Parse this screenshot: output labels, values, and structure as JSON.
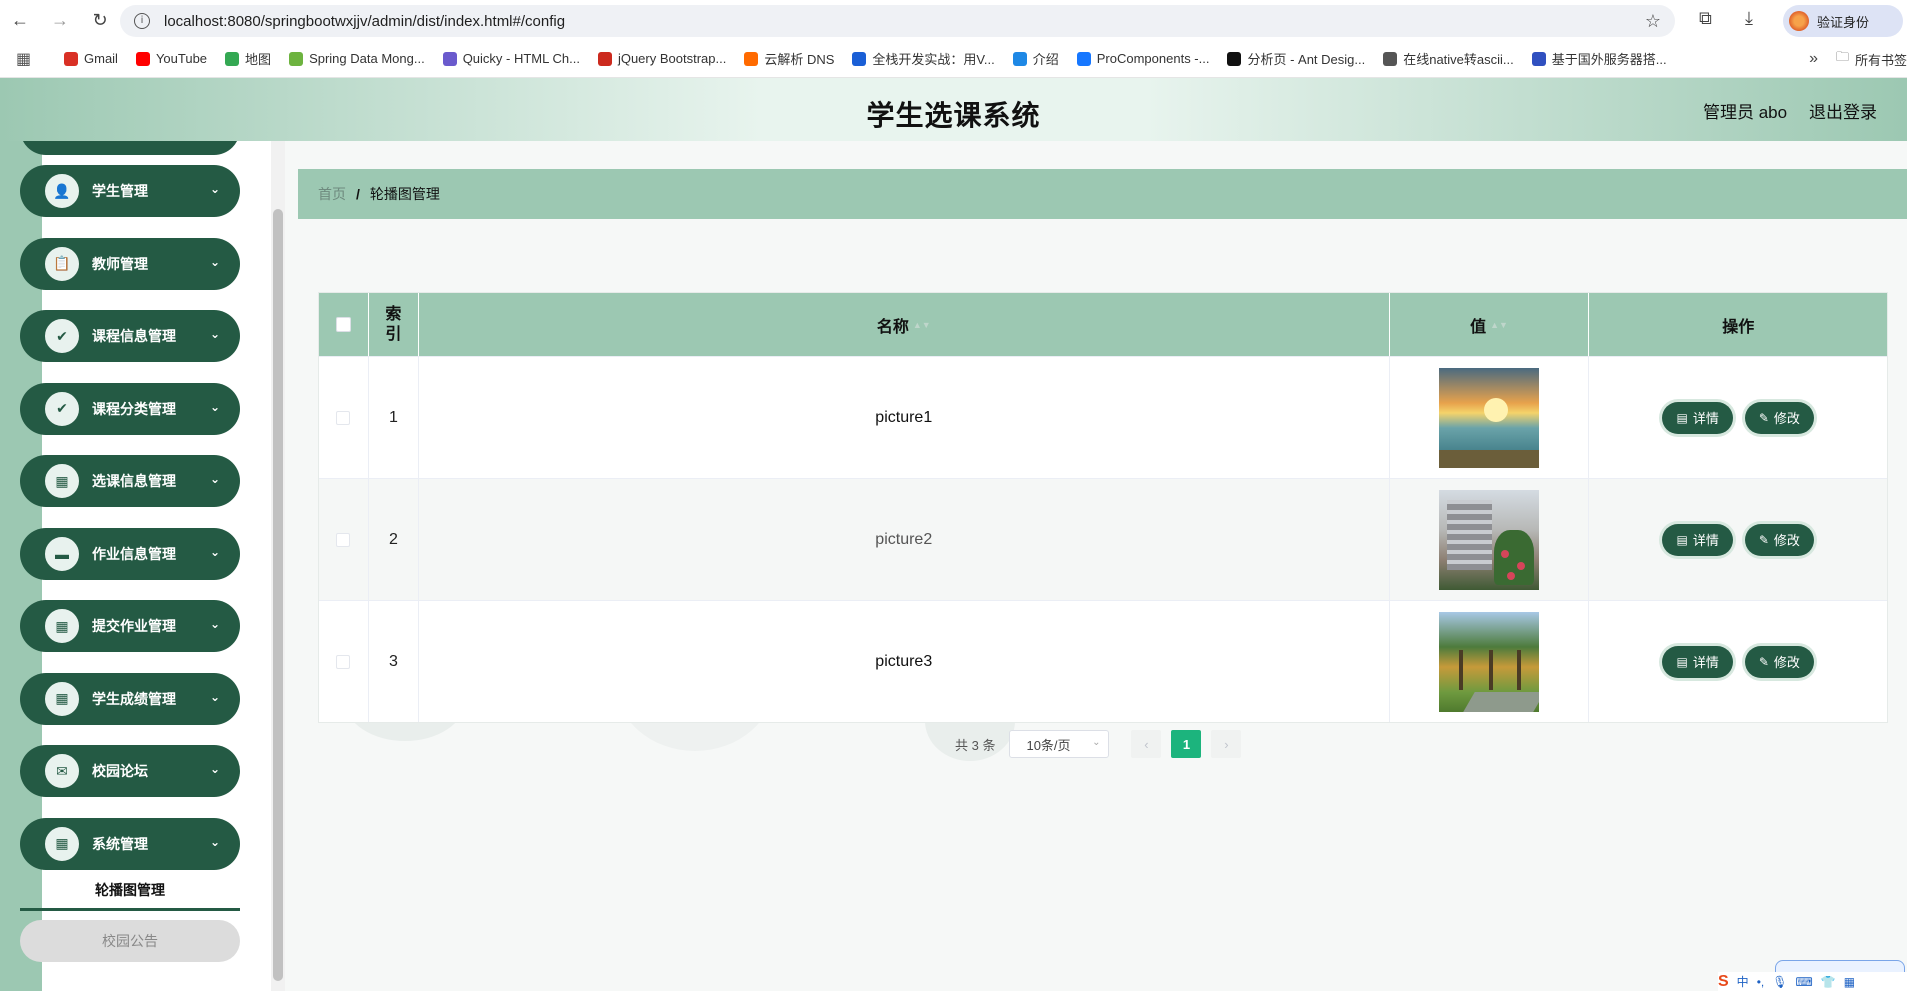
{
  "browser": {
    "url": "localhost:8080/springbootwxjjv/admin/dist/index.html#/config",
    "verify_label": "验证身份",
    "bookmarks": [
      {
        "label": "Gmail",
        "color": "#d93025"
      },
      {
        "label": "YouTube",
        "color": "#ff0000"
      },
      {
        "label": "地图",
        "color": "#34a853"
      },
      {
        "label": "Spring Data Mong...",
        "color": "#6db33f"
      },
      {
        "label": "Quicky - HTML Ch...",
        "color": "#6a5acd"
      },
      {
        "label": "jQuery Bootstrap...",
        "color": "#cc2a1e"
      },
      {
        "label": "云解析 DNS",
        "color": "#ff6a00"
      },
      {
        "label": "全栈开发实战：用V...",
        "color": "#1a5fd6"
      },
      {
        "label": "介绍",
        "color": "#1e88e5"
      },
      {
        "label": "ProComponents -...",
        "color": "#1677ff"
      },
      {
        "label": "分析页 - Ant Desig...",
        "color": "#111111"
      },
      {
        "label": "在线native转ascii...",
        "color": "#555555"
      },
      {
        "label": "基于国外服务器搭...",
        "color": "#3050c0"
      }
    ],
    "all_bookmarks": "所有书签"
  },
  "header": {
    "title": "学生选课系统",
    "admin": "管理员 abo",
    "logout": "退出登录"
  },
  "sidebar": {
    "items": [
      {
        "label": "学生管理",
        "icon": "user-icon"
      },
      {
        "label": "教师管理",
        "icon": "clipboard-icon"
      },
      {
        "label": "课程信息管理",
        "icon": "clipboard-check-icon"
      },
      {
        "label": "课程分类管理",
        "icon": "clipboard-check-icon"
      },
      {
        "label": "选课信息管理",
        "icon": "grid-icon"
      },
      {
        "label": "作业信息管理",
        "icon": "monitor-icon"
      },
      {
        "label": "提交作业管理",
        "icon": "grid-icon"
      },
      {
        "label": "学生成绩管理",
        "icon": "grid-icon"
      },
      {
        "label": "校园论坛",
        "icon": "chat-icon"
      },
      {
        "label": "系统管理",
        "icon": "grid-icon"
      }
    ],
    "sub_active": "轮播图管理",
    "sub_item": "校园公告"
  },
  "breadcrumb": {
    "home": "首页",
    "separator": "/",
    "current": "轮播图管理"
  },
  "table": {
    "headers": {
      "index": [
        "索",
        "引"
      ],
      "name": "名称",
      "value": "值",
      "actions": "操作"
    },
    "rows": [
      {
        "index": "1",
        "name": "picture1"
      },
      {
        "index": "2",
        "name": "picture2"
      },
      {
        "index": "3",
        "name": "picture3"
      }
    ],
    "detail_label": "详情",
    "edit_label": "修改"
  },
  "pagination": {
    "total": "共 3 条",
    "page_size": "10条/页",
    "current_page": "1"
  },
  "colors": {
    "primary": "#245a44",
    "accent": "#9cc8b2",
    "page_active": "#1cb47d"
  }
}
